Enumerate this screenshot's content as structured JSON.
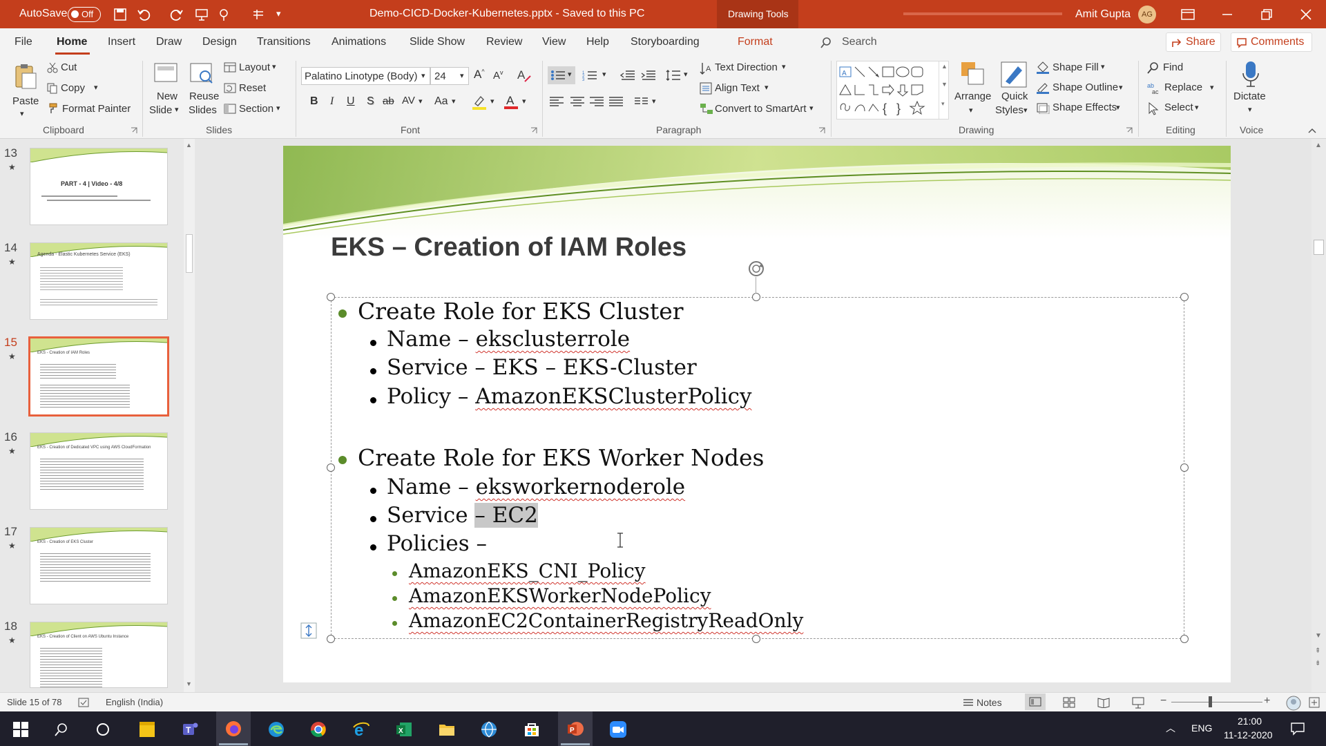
{
  "titlebar": {
    "autosave_label": "AutoSave",
    "autosave_state": "Off",
    "doc_title": "Demo-CICD-Docker-Kubernetes.pptx  -  Saved to this PC",
    "context_tab": "Drawing Tools",
    "user_name": "Amit Gupta",
    "user_initials": "AG"
  },
  "menu": {
    "items": [
      "File",
      "Home",
      "Insert",
      "Draw",
      "Design",
      "Transitions",
      "Animations",
      "Slide Show",
      "Review",
      "View",
      "Help",
      "Storyboarding",
      "Format"
    ],
    "active": "Home",
    "search_label": "Search",
    "share_label": "Share",
    "comments_label": "Comments"
  },
  "ribbon": {
    "clipboard": {
      "paste": "Paste",
      "cut": "Cut",
      "copy": "Copy",
      "format_painter": "Format Painter",
      "label": "Clipboard"
    },
    "slides": {
      "new_slide_1": "New",
      "new_slide_2": "Slide",
      "reuse_1": "Reuse",
      "reuse_2": "Slides",
      "layout": "Layout",
      "reset": "Reset",
      "section": "Section",
      "label": "Slides"
    },
    "font": {
      "font_name": "Palatino Linotype (Body)",
      "font_size": "24",
      "bold": "B",
      "italic": "I",
      "underline": "U",
      "shadow": "S",
      "strike": "ab",
      "spacing": "AV",
      "case": "Aa",
      "label": "Font"
    },
    "paragraph": {
      "text_direction": "Text Direction",
      "align_text": "Align Text",
      "convert_smartart": "Convert to SmartArt",
      "label": "Paragraph"
    },
    "drawing": {
      "arrange": "Arrange",
      "quick_1": "Quick",
      "quick_2": "Styles",
      "shape_fill": "Shape Fill",
      "shape_outline": "Shape Outline",
      "shape_effects": "Shape Effects",
      "label": "Drawing"
    },
    "editing": {
      "find": "Find",
      "replace": "Replace",
      "select": "Select",
      "label": "Editing"
    },
    "voice": {
      "dictate": "Dictate",
      "label": "Voice"
    }
  },
  "thumbnails": [
    {
      "num": "13",
      "title": "PART - 4 | Video - 4/8"
    },
    {
      "num": "14",
      "title": "Agenda - Elastic Kubernetes Service (EKS)"
    },
    {
      "num": "15",
      "title": "EKS - Creation of IAM Roles"
    },
    {
      "num": "16",
      "title": "EKS - Creation of Dedicated VPC using AWS CloudFormation"
    },
    {
      "num": "17",
      "title": "EKS - Creation of EKS Cluster"
    },
    {
      "num": "18",
      "title": "EKS - Creation of Client on AWS Ubuntu Instance"
    }
  ],
  "slide": {
    "title": "EKS – Creation of IAM Roles",
    "b1": "Create Role for EKS Cluster",
    "b1_name_prefix": "Name – ",
    "b1_name_value": "eksclusterrole",
    "b1_service": "Service – EKS – EKS-Cluster",
    "b1_policy_prefix": "Policy – ",
    "b1_policy_value": "AmazonEKSClusterPolicy",
    "b2": "Create Role for EKS Worker Nodes",
    "b2_name_prefix": "Name – ",
    "b2_name_value": "eksworkernoderole",
    "b2_service_prefix": "Service ",
    "b2_service_value": "– EC2",
    "b2_policies": "Policies –",
    "p1": "AmazonEKS_CNI_Policy",
    "p2": "AmazonEKSWorkerNodePolicy",
    "p3": "AmazonEC2ContainerRegistryReadOnly"
  },
  "status": {
    "slide_info": "Slide 15 of 78",
    "language": "English (India)",
    "notes": "Notes"
  },
  "taskbar": {
    "time": "21:00",
    "date": "11-12-2020",
    "lang": "ENG"
  },
  "colors": {
    "accent": "#c43e1c",
    "bullet": "#5b8c2a",
    "title": "#3b3b3b"
  }
}
